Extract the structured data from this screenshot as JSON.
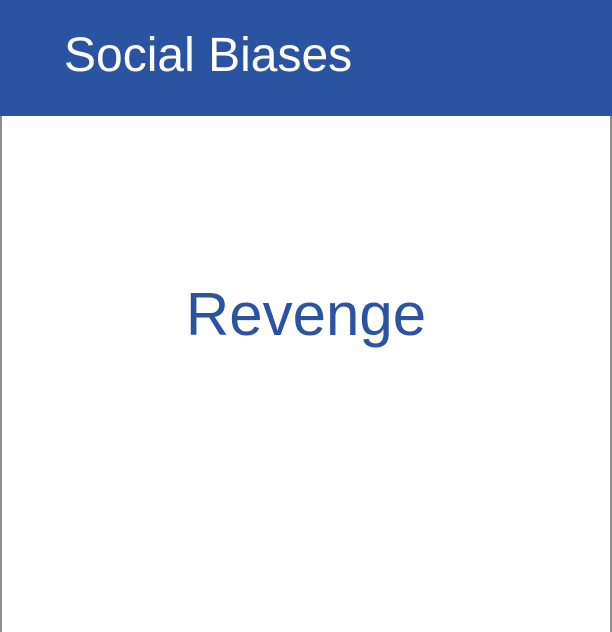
{
  "header": {
    "title": "Social Biases"
  },
  "card": {
    "term": "Revenge"
  },
  "colors": {
    "header_background": "#2a54a1",
    "header_text": "#ffffff",
    "term_text": "#2a54a1",
    "card_background": "#ffffff",
    "border": "#8f8f8f"
  }
}
